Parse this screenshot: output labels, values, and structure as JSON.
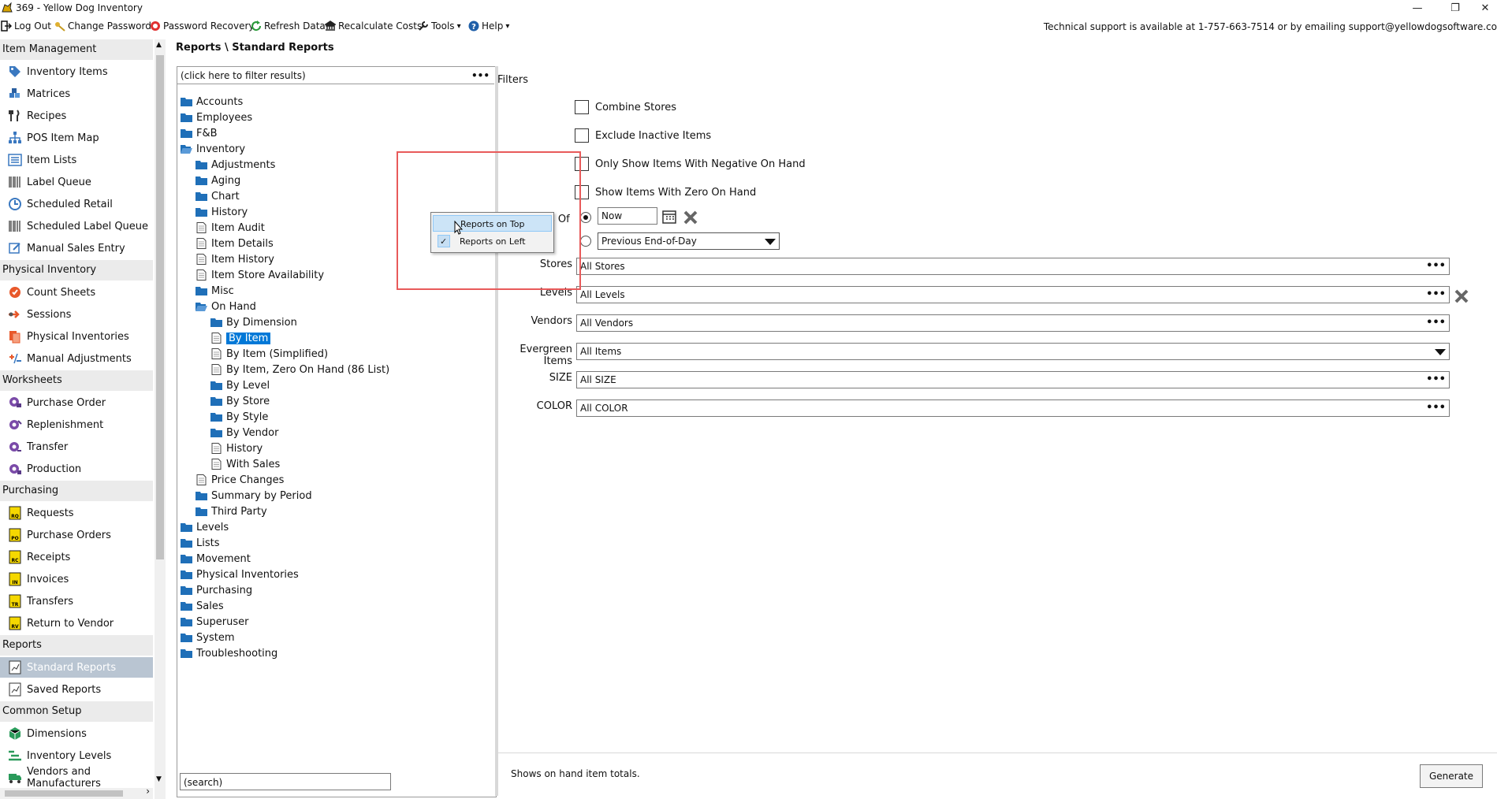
{
  "window": {
    "title": "369 - Yellow Dog Inventory",
    "controls": {
      "minimize": "—",
      "restore": "❐",
      "close": "✕"
    }
  },
  "toolbar": {
    "items": [
      {
        "label": "Log Out",
        "icon": "logout-icon"
      },
      {
        "label": "Change Password",
        "icon": "key-icon"
      },
      {
        "label": "Password Recovery",
        "icon": "lifebuoy-icon"
      },
      {
        "label": "Refresh Data",
        "icon": "refresh-icon"
      },
      {
        "label": "Recalculate Costs",
        "icon": "bank-icon"
      },
      {
        "label": "Tools",
        "icon": "wrench-icon",
        "dropdown": "▾"
      },
      {
        "label": "Help",
        "icon": "help-icon",
        "dropdown": "▾"
      }
    ],
    "support": "Technical support is available at 1-757-663-7514 or by emailing support@yellowdogsoftware.co"
  },
  "sidebar": {
    "sections": [
      {
        "title": "Item Management",
        "items": [
          "Inventory Items",
          "Matrices",
          "Recipes",
          "POS Item Map",
          "Item Lists",
          "Label Queue",
          "Scheduled Retail",
          "Scheduled Label Queue",
          "Manual Sales Entry"
        ]
      },
      {
        "title": "Physical Inventory",
        "items": [
          "Count Sheets",
          "Sessions",
          "Physical Inventories",
          "Manual Adjustments"
        ]
      },
      {
        "title": "Worksheets",
        "items": [
          "Purchase Order",
          "Replenishment",
          "Transfer",
          "Production"
        ]
      },
      {
        "title": "Purchasing",
        "items": [
          "Requests",
          "Purchase Orders",
          "Receipts",
          "Invoices",
          "Transfers",
          "Return to Vendor"
        ]
      },
      {
        "title": "Reports",
        "items": [
          "Standard Reports",
          "Saved Reports"
        ]
      },
      {
        "title": "Common Setup",
        "items": [
          "Dimensions",
          "Inventory Levels",
          "Vendors and Manufacturers"
        ]
      }
    ],
    "selected": "Standard Reports",
    "scroll_up": "▲",
    "scroll_down": "▼",
    "scroll_right": "›"
  },
  "breadcrumb": "Reports \\ Standard Reports",
  "tree": {
    "filter_placeholder": "(click here to filter results)",
    "filter_more": "•••",
    "search": "(search)",
    "nodes": [
      {
        "label": "Accounts",
        "type": "folder",
        "level": 0
      },
      {
        "label": "Employees",
        "type": "folder",
        "level": 0
      },
      {
        "label": "F&B",
        "type": "folder",
        "level": 0
      },
      {
        "label": "Inventory",
        "type": "open",
        "level": 0
      },
      {
        "label": "Adjustments",
        "type": "folder",
        "level": 1
      },
      {
        "label": "Aging",
        "type": "folder",
        "level": 1
      },
      {
        "label": "Chart",
        "type": "folder",
        "level": 1
      },
      {
        "label": "History",
        "type": "folder",
        "level": 1
      },
      {
        "label": "Item Audit",
        "type": "doc",
        "level": 1
      },
      {
        "label": "Item Details",
        "type": "doc",
        "level": 1
      },
      {
        "label": "Item History",
        "type": "doc",
        "level": 1
      },
      {
        "label": "Item Store Availability",
        "type": "doc",
        "level": 1
      },
      {
        "label": "Misc",
        "type": "folder",
        "level": 1
      },
      {
        "label": "On Hand",
        "type": "open",
        "level": 1
      },
      {
        "label": "By Dimension",
        "type": "folder",
        "level": 2
      },
      {
        "label": "By Item",
        "type": "doc",
        "level": 2,
        "selected": true
      },
      {
        "label": "By Item (Simplified)",
        "type": "doc",
        "level": 2
      },
      {
        "label": "By Item, Zero On Hand (86 List)",
        "type": "doc",
        "level": 2
      },
      {
        "label": "By Level",
        "type": "folder",
        "level": 2
      },
      {
        "label": "By Store",
        "type": "folder",
        "level": 2
      },
      {
        "label": "By Style",
        "type": "folder",
        "level": 2
      },
      {
        "label": "By Vendor",
        "type": "folder",
        "level": 2
      },
      {
        "label": "History",
        "type": "doc",
        "level": 2
      },
      {
        "label": "With Sales",
        "type": "doc",
        "level": 2
      },
      {
        "label": "Price Changes",
        "type": "doc",
        "level": 1
      },
      {
        "label": "Summary by Period",
        "type": "folder",
        "level": 1
      },
      {
        "label": "Third Party",
        "type": "folder",
        "level": 1
      },
      {
        "label": "Levels",
        "type": "folder",
        "level": 0
      },
      {
        "label": "Lists",
        "type": "folder",
        "level": 0
      },
      {
        "label": "Movement",
        "type": "folder",
        "level": 0
      },
      {
        "label": "Physical Inventories",
        "type": "folder",
        "level": 0
      },
      {
        "label": "Purchasing",
        "type": "folder",
        "level": 0
      },
      {
        "label": "Sales",
        "type": "folder",
        "level": 0
      },
      {
        "label": "Superuser",
        "type": "folder",
        "level": 0
      },
      {
        "label": "System",
        "type": "folder",
        "level": 0
      },
      {
        "label": "Troubleshooting",
        "type": "folder",
        "level": 0
      }
    ]
  },
  "filters": {
    "title": "Filters",
    "checkboxes": [
      "Combine Stores",
      "Exclude Inactive Items",
      "Only Show Items With Negative On Hand",
      "Show Items With Zero On Hand"
    ],
    "as_of_label": "s Of",
    "as_of_value": "Now",
    "as_of_option2": "Previous End-of-Day",
    "fields": [
      {
        "label": "Stores",
        "value": "All Stores",
        "control": "dots"
      },
      {
        "label": "Levels",
        "value": "All Levels",
        "control": "dots",
        "clear": true
      },
      {
        "label": "Vendors",
        "value": "All Vendors",
        "control": "dots"
      },
      {
        "label": "Evergreen Items",
        "value": "All Items",
        "control": "dropdown"
      },
      {
        "label": "SIZE",
        "value": "All SIZE",
        "control": "dots"
      },
      {
        "label": "COLOR",
        "value": "All COLOR",
        "control": "dots"
      }
    ],
    "more_glyph": "•••",
    "description": "Shows on hand item totals.",
    "generate": "Generate"
  },
  "context_menu": {
    "items": [
      {
        "label": "Reports on Top",
        "hover": true,
        "checked": false
      },
      {
        "label": "Reports on Left",
        "hover": false,
        "checked": true
      }
    ],
    "check_glyph": "✓"
  },
  "colors": {
    "selection": "#0078d7",
    "sidebar_selected": "#b9c5d2",
    "folder": "#1f6fb8",
    "highlight_box": "#e85a5a"
  }
}
